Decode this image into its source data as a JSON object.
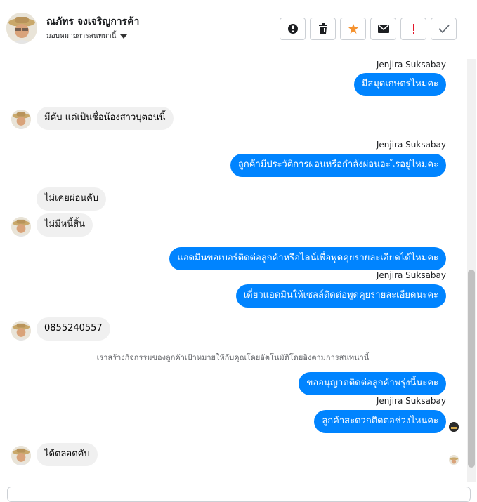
{
  "header": {
    "contact_name": "ณภัทร จงเจริญการค้า",
    "assign_label": "มอบหมายการสนทนานี้"
  },
  "messages": {
    "m1_sender": "Jenjira Suksabay",
    "m1_text": "มีสมุดเกษตรไหมคะ",
    "m2_text": "มีคับ แต่เป็นชื่อน้องสาวบุตอนนี้",
    "m3_sender": "Jenjira Suksabay",
    "m3_text": "ลูกค้ามีประวัติการผ่อนหรือกำลังผ่อนอะไรอยู่ไหมคะ",
    "m4_text": "ไม่เคยผ่อนคับ",
    "m5_text": "ไม่มีหนี้สิ้น",
    "m6_text": "แอดมินขอเบอร์ติดต่อลูกค้าหรือไลน์เพื่อพูดคุยรายละเอียดได้ไหมคะ",
    "m7_sender": "Jenjira Suksabay",
    "m7_text": "เดี๋ยวแอดมินให้เซลล์ติดต่อพูดคุยรายละเอียดนะคะ",
    "m8_text": "0855240557",
    "system_text": "เราสร้างกิจกรรมของลูกค้าเป้าหมายให้กับคุณโดยอัตโนมัติโดยอิงตามการสนทนานี้",
    "m9_text": "ขออนุญาตติดต่อลูกค้าพรุ่งนี้นะคะ",
    "m10_sender": "Jenjira Suksabay",
    "m10_text": "ลูกค้าสะดวกติดต่อช่วงไหนคะ",
    "m11_text": "ได้ตลอดคับ"
  },
  "icons": {
    "alert": "exclamation-circle-icon",
    "trash": "trash-icon",
    "star": "star-icon",
    "mail": "envelope-icon",
    "priority": "exclamation-icon",
    "done": "checkmark-icon"
  },
  "colors": {
    "outgoing_bubble": "#0084ff",
    "incoming_bubble": "#f0f0f0",
    "star": "#f5922f",
    "priority": "#e4162a"
  }
}
